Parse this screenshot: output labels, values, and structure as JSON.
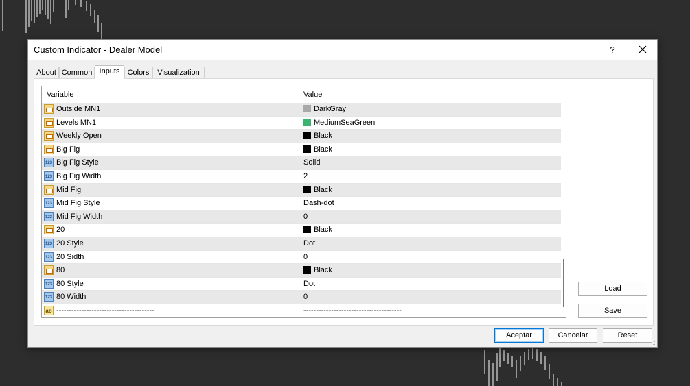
{
  "window": {
    "title": "Custom Indicator - Dealer Model",
    "help_label": "?",
    "close_icon": "close-icon"
  },
  "tabs": [
    {
      "label": "About",
      "active": false
    },
    {
      "label": "Common",
      "active": false
    },
    {
      "label": "Inputs",
      "active": true
    },
    {
      "label": "Colors",
      "active": false
    },
    {
      "label": "Visualization",
      "active": false
    }
  ],
  "table": {
    "headers": {
      "variable": "Variable",
      "value": "Value"
    },
    "rows": [
      {
        "icon": "color-icon",
        "name": "Outside MN1",
        "value": "DarkGray",
        "swatch": "#a9a9a9"
      },
      {
        "icon": "color-icon",
        "name": "Levels MN1",
        "value": "MediumSeaGreen",
        "swatch": "#3cb371"
      },
      {
        "icon": "color-icon",
        "name": "Weekly Open",
        "value": "Black",
        "swatch": "#000000"
      },
      {
        "icon": "color-icon",
        "name": "Big Fig",
        "value": "Black",
        "swatch": "#000000"
      },
      {
        "icon": "number-icon",
        "name": "Big Fig Style",
        "value": "Solid"
      },
      {
        "icon": "number-icon",
        "name": "Big Fig Width",
        "value": "2"
      },
      {
        "icon": "color-icon",
        "name": "Mid Fig",
        "value": "Black",
        "swatch": "#000000"
      },
      {
        "icon": "number-icon",
        "name": "Mid Fig Style",
        "value": "Dash-dot"
      },
      {
        "icon": "number-icon",
        "name": "Mid Fig Width",
        "value": "0"
      },
      {
        "icon": "color-icon",
        "name": "20",
        "value": "Black",
        "swatch": "#000000"
      },
      {
        "icon": "number-icon",
        "name": "20 Style",
        "value": "Dot"
      },
      {
        "icon": "number-icon",
        "name": "20 Sidth",
        "value": "0"
      },
      {
        "icon": "color-icon",
        "name": "80",
        "value": "Black",
        "swatch": "#000000"
      },
      {
        "icon": "number-icon",
        "name": "80 Style",
        "value": "Dot"
      },
      {
        "icon": "number-icon",
        "name": "80 Width",
        "value": "0"
      },
      {
        "icon": "string-icon",
        "name": "---------------------------------------",
        "value": "---------------------------------------"
      }
    ]
  },
  "side_buttons": {
    "load": "Load",
    "save": "Save"
  },
  "footer_buttons": {
    "ok": "Aceptar",
    "cancel": "Cancelar",
    "reset": "Reset"
  }
}
